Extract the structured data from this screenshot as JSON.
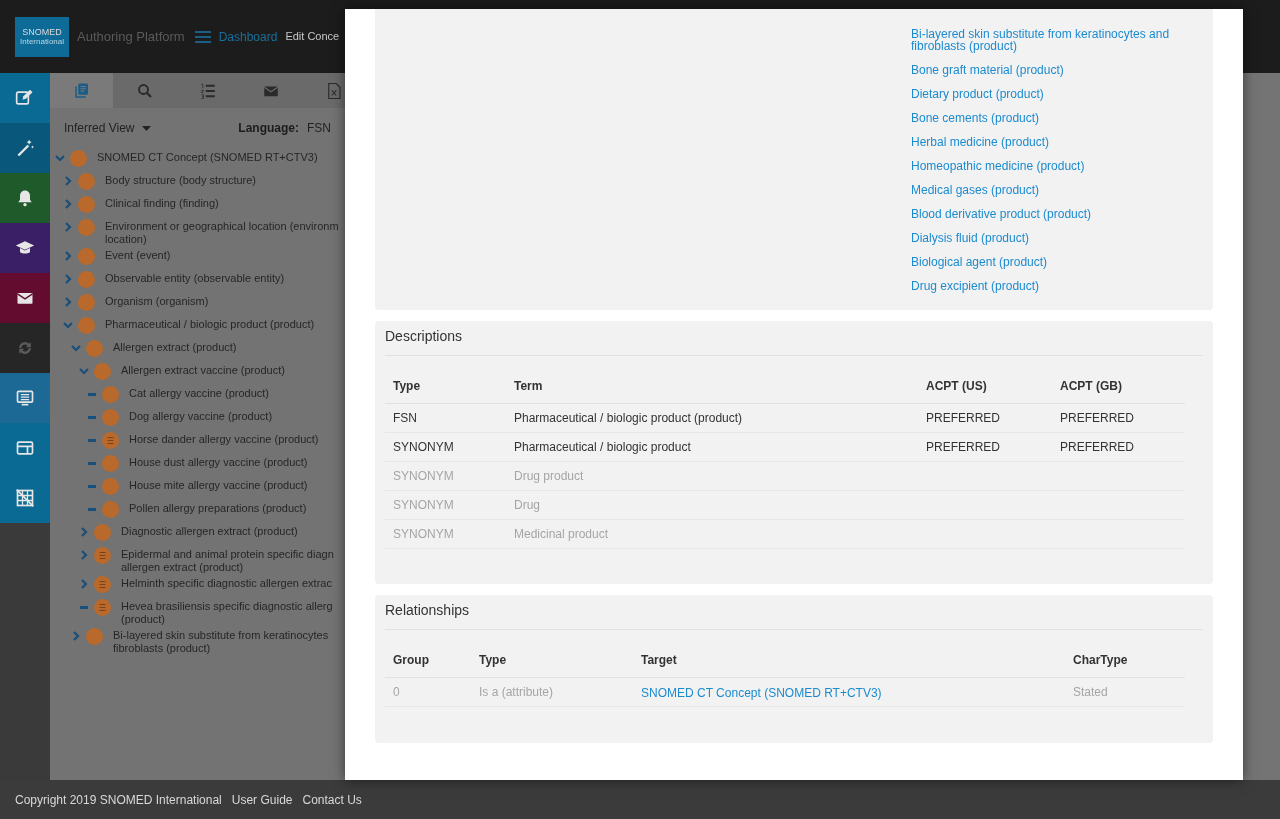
{
  "header": {
    "logo": {
      "line_1": "SNOMED",
      "line_2": "International"
    },
    "app_title": "Authoring Platform",
    "nav": [
      {
        "label": "Dashboard",
        "kind": "link"
      },
      {
        "label": "Edit Conce",
        "kind": "text"
      }
    ]
  },
  "sidebar": {
    "items": [
      {
        "color": "#0b6a93"
      },
      {
        "color": "#09587c"
      },
      {
        "color": "#1f5a2b"
      },
      {
        "color": "#3b1f66"
      },
      {
        "color": "#640c30"
      },
      {
        "color": "#262626"
      },
      {
        "color": "#1c6996"
      },
      {
        "color": "#0b6a93"
      },
      {
        "color": "#0b6a93"
      }
    ]
  },
  "taxonomy": {
    "tabs": [
      {
        "selected": true
      },
      {
        "selected": false
      },
      {
        "selected": false
      },
      {
        "selected": false
      },
      {
        "selected": false
      }
    ],
    "view": "Inferred View",
    "language_label": "Language:",
    "language": "FSN",
    "tree": [
      {
        "lines": [
          "SNOMED CT Concept (SNOMED RT+CTV3)"
        ],
        "kind": "branch",
        "expanded": true,
        "defined": false,
        "children": [
          {
            "lines": [
              "Body structure (body structure)"
            ],
            "kind": "branch",
            "expanded": false,
            "defined": false
          },
          {
            "lines": [
              "Clinical finding (finding)"
            ],
            "kind": "branch",
            "expanded": false,
            "defined": false
          },
          {
            "lines": [
              "Environment or geographical location (environm",
              "location)"
            ],
            "kind": "branch",
            "expanded": false,
            "defined": false
          },
          {
            "lines": [
              "Event (event)"
            ],
            "kind": "branch",
            "expanded": false,
            "defined": false
          },
          {
            "lines": [
              "Observable entity (observable entity)"
            ],
            "kind": "branch",
            "expanded": false,
            "defined": false
          },
          {
            "lines": [
              "Organism (organism)"
            ],
            "kind": "branch",
            "expanded": false,
            "defined": false
          },
          {
            "lines": [
              "Pharmaceutical / biologic product (product)"
            ],
            "kind": "branch",
            "expanded": true,
            "defined": false,
            "children": [
              {
                "lines": [
                  "Allergen extract (product)"
                ],
                "kind": "branch",
                "expanded": true,
                "defined": false,
                "children": [
                  {
                    "lines": [
                      "Allergen extract vaccine (product)"
                    ],
                    "kind": "branch",
                    "expanded": true,
                    "defined": false,
                    "children": [
                      {
                        "lines": [
                          "Cat allergy vaccine (product)"
                        ],
                        "kind": "leaf",
                        "defined": false
                      },
                      {
                        "lines": [
                          "Dog allergy vaccine (product)"
                        ],
                        "kind": "leaf",
                        "defined": false
                      },
                      {
                        "lines": [
                          "Horse dander allergy vaccine (product)"
                        ],
                        "kind": "leaf",
                        "defined": true
                      },
                      {
                        "lines": [
                          "House dust allergy vaccine (product)"
                        ],
                        "kind": "leaf",
                        "defined": false
                      },
                      {
                        "lines": [
                          "House mite allergy vaccine (product)"
                        ],
                        "kind": "leaf",
                        "defined": false
                      },
                      {
                        "lines": [
                          "Pollen allergy preparations (product)"
                        ],
                        "kind": "leaf",
                        "defined": false
                      }
                    ]
                  },
                  {
                    "lines": [
                      "Diagnostic allergen extract (product)"
                    ],
                    "kind": "branch",
                    "expanded": false,
                    "defined": false
                  },
                  {
                    "lines": [
                      "Epidermal and animal protein specific diagn",
                      "allergen extract (product)"
                    ],
                    "kind": "branch",
                    "expanded": false,
                    "defined": true
                  },
                  {
                    "lines": [
                      "Helminth specific diagnostic allergen extrac"
                    ],
                    "kind": "branch",
                    "expanded": false,
                    "defined": true
                  },
                  {
                    "lines": [
                      "Hevea brasiliensis specific diagnostic allerg",
                      "(product)"
                    ],
                    "kind": "leaf",
                    "defined": true
                  }
                ]
              },
              {
                "lines": [
                  "Bi-layered skin substitute from keratinocytes",
                  "fibroblasts (product)"
                ],
                "kind": "branch",
                "expanded": false,
                "defined": false
              }
            ]
          }
        ]
      }
    ]
  },
  "modal": {
    "children_list": [
      "Bi-layered skin substitute from keratinocytes and fibroblasts (product)",
      "Bone graft material (product)",
      "Dietary product (product)",
      "Bone cements (product)",
      "Herbal medicine (product)",
      "Homeopathic medicine (product)",
      "Medical gases (product)",
      "Blood derivative product (product)",
      "Dialysis fluid (product)",
      "Biological agent (product)",
      "Drug excipient (product)"
    ],
    "descriptions": {
      "title": "Descriptions",
      "columns": [
        "Type",
        "Term",
        "ACPT (US)",
        "ACPT (GB)"
      ],
      "rows": [
        {
          "active": true,
          "cells": [
            "FSN",
            "Pharmaceutical / biologic product (product)",
            "PREFERRED",
            "PREFERRED"
          ]
        },
        {
          "active": true,
          "cells": [
            "SYNONYM",
            "Pharmaceutical / biologic product",
            "PREFERRED",
            "PREFERRED"
          ]
        },
        {
          "active": false,
          "cells": [
            "SYNONYM",
            "Drug product",
            "",
            ""
          ]
        },
        {
          "active": false,
          "cells": [
            "SYNONYM",
            "Drug",
            "",
            ""
          ]
        },
        {
          "active": false,
          "cells": [
            "SYNONYM",
            "Medicinal product",
            "",
            ""
          ]
        }
      ]
    },
    "relationships": {
      "title": "Relationships",
      "columns": [
        "Group",
        "Type",
        "Target",
        "CharType"
      ],
      "rows": [
        {
          "group": "0",
          "type": "Is a (attribute)",
          "target": "SNOMED CT Concept (SNOMED RT+CTV3)",
          "char_type": "Stated"
        }
      ]
    }
  },
  "footer": {
    "copyright": "Copyright 2019 SNOMED International",
    "links": [
      "User Guide",
      "Contact Us"
    ]
  }
}
